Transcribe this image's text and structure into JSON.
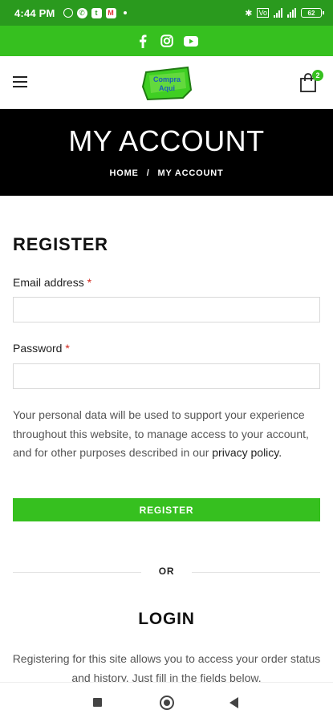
{
  "status_bar": {
    "time": "4:44 PM",
    "battery": "62",
    "notification_icons": [
      "alarm-icon",
      "whatsapp-icon",
      "twitter-icon",
      "gmail-icon"
    ],
    "system_icons": [
      "bluetooth-icon",
      "volte-icon",
      "signal-icon",
      "wifi-icon",
      "battery-icon"
    ]
  },
  "social_bar": {
    "icons": [
      "facebook-icon",
      "instagram-icon",
      "youtube-icon"
    ],
    "color": "#36c01f"
  },
  "header": {
    "logo_text": "Compra Aqui",
    "cart_count": "2"
  },
  "banner": {
    "title": "MY ACCOUNT",
    "breadcrumb": {
      "home": "HOME",
      "separator": "/",
      "current": "MY ACCOUNT"
    }
  },
  "register": {
    "title": "REGISTER",
    "email_label": "Email address",
    "password_label": "Password",
    "required_mark": "*",
    "email_value": "",
    "password_value": "",
    "privacy_note": "Your personal data will be used to support your experience throughout this website, to manage access to your account, and for other purposes described in our",
    "privacy_link": "privacy policy",
    "privacy_end": ".",
    "button_label": "REGISTER"
  },
  "separator": {
    "label": "OR"
  },
  "login": {
    "title": "LOGIN",
    "text": "Registering for this site allows you to access your order status and history. Just fill in the fields below."
  },
  "colors": {
    "accent": "#36c01f",
    "status_bar": "#2a9a1e",
    "banner": "#000000",
    "required": "#d0261c"
  }
}
